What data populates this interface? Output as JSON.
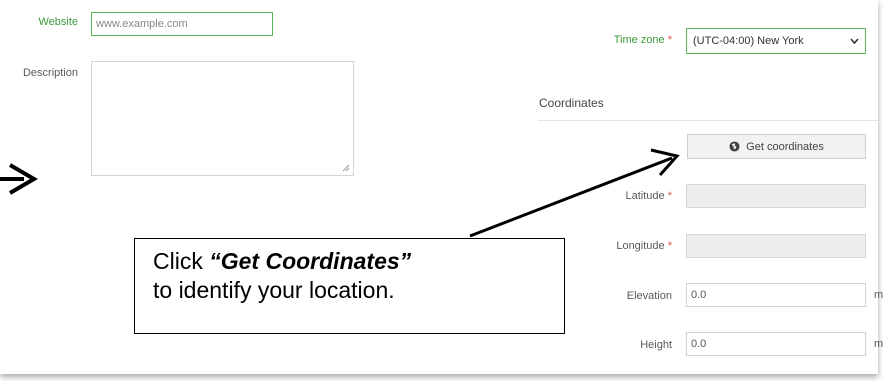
{
  "form": {
    "website": {
      "label": "Website",
      "placeholder": "www.example.com"
    },
    "description": {
      "label": "Description",
      "value": ""
    },
    "timezone": {
      "label": "Time zone",
      "required_mark": "*",
      "selected": "(UTC-04:00) New York"
    },
    "coordinates": {
      "section_title": "Coordinates",
      "get_button_label": "Get coordinates",
      "latitude": {
        "label": "Latitude",
        "required_mark": "*",
        "value": ""
      },
      "longitude": {
        "label": "Longitude",
        "required_mark": "*",
        "value": ""
      },
      "elevation": {
        "label": "Elevation",
        "value": "0.0",
        "unit": "m"
      },
      "height": {
        "label": "Height",
        "value": "0.0",
        "unit": "m"
      }
    }
  },
  "callout": {
    "line1_prefix": "Click",
    "line1_emphasis": "“Get Coordinates”",
    "line2": "to identify your location."
  },
  "colors": {
    "accent_green": "#59b75c",
    "required_red": "#d9534f"
  },
  "icons": {
    "globe": "globe-icon",
    "dropdown": "chevron-down-icon",
    "resize": "resize-handle-icon"
  }
}
